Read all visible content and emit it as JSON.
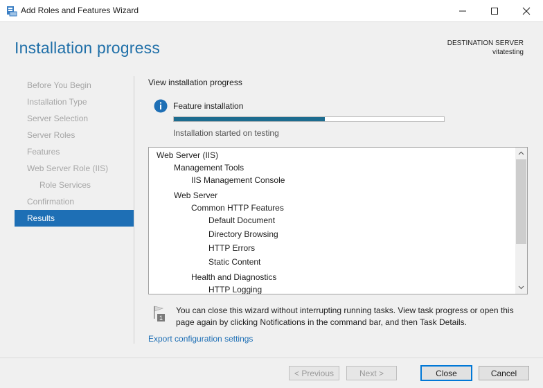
{
  "window": {
    "title": "Add Roles and Features Wizard",
    "app_icon": "server-manager-icon"
  },
  "header": {
    "page_title": "Installation progress",
    "destination_label": "DESTINATION SERVER",
    "destination_server": "vitatesting"
  },
  "nav": {
    "items": [
      {
        "label": "Before You Begin",
        "state": "disabled"
      },
      {
        "label": "Installation Type",
        "state": "disabled"
      },
      {
        "label": "Server Selection",
        "state": "disabled"
      },
      {
        "label": "Server Roles",
        "state": "disabled"
      },
      {
        "label": "Features",
        "state": "disabled"
      },
      {
        "label": "Web Server Role (IIS)",
        "state": "disabled"
      },
      {
        "label": "Role Services",
        "state": "disabled",
        "sub": true
      },
      {
        "label": "Confirmation",
        "state": "disabled"
      },
      {
        "label": "Results",
        "state": "active"
      }
    ]
  },
  "main": {
    "view_label": "View installation progress",
    "feature_label": "Feature installation",
    "progress": 0.56,
    "started_label": "Installation started on testing",
    "tree": [
      {
        "text": "Web Server (IIS)",
        "level": 0
      },
      {
        "text": "Management Tools",
        "level": 1
      },
      {
        "text": "IIS Management Console",
        "level": 2
      },
      {
        "text": "Web Server",
        "level": 1
      },
      {
        "text": "Common HTTP Features",
        "level": 2
      },
      {
        "text": "Default Document",
        "level": 3
      },
      {
        "text": "Directory Browsing",
        "level": 3
      },
      {
        "text": "HTTP Errors",
        "level": 3
      },
      {
        "text": "Static Content",
        "level": 3
      },
      {
        "text": "Health and Diagnostics",
        "level": 2
      },
      {
        "text": "HTTP Logging",
        "level": 3
      }
    ],
    "note_text": "You can close this wizard without interrupting running tasks. View task progress or open this page again by clicking Notifications in the command bar, and then Task Details.",
    "note_icon": "notification-flag-icon",
    "export_link": "Export configuration settings"
  },
  "footer": {
    "previous_label": "< Previous",
    "next_label": "Next >",
    "close_label": "Close",
    "cancel_label": "Cancel"
  },
  "colors": {
    "title_blue": "#1f6fa8",
    "nav_active": "#1e6fb5",
    "progress_fill": "#1d6c8f"
  }
}
